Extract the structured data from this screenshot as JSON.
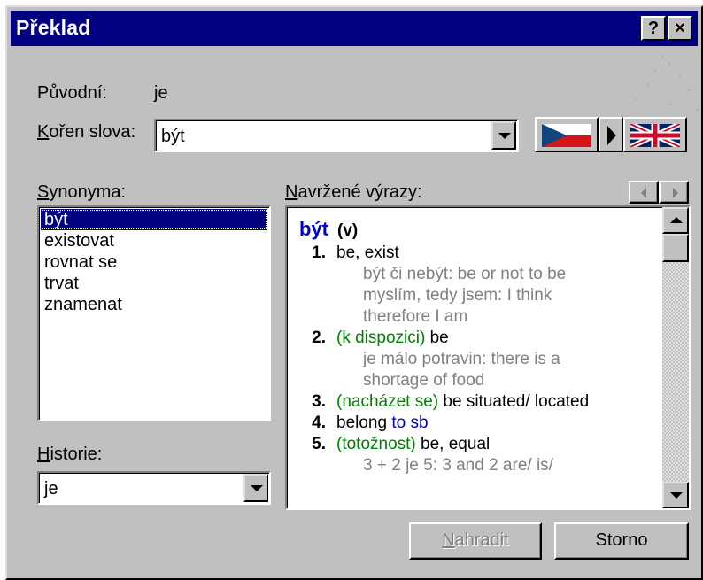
{
  "window": {
    "title": "Překlad",
    "help_label": "?",
    "close_label": "×"
  },
  "original": {
    "label": "Původní:",
    "value": "je"
  },
  "root": {
    "label_accel": "K",
    "label_rest": "ořen slova:",
    "value": "být"
  },
  "flags": {
    "source": "czech-flag-icon",
    "direction": "arrow-right-icon",
    "target": "uk-flag-icon"
  },
  "synonyms": {
    "label_accel": "S",
    "label_rest": "ynonyma:",
    "items": [
      {
        "text": "být",
        "selected": true
      },
      {
        "text": "existovat",
        "selected": false
      },
      {
        "text": "rovnat se",
        "selected": false
      },
      {
        "text": "trvat",
        "selected": false
      },
      {
        "text": "znamenat",
        "selected": false
      }
    ]
  },
  "suggestions": {
    "label_accel": "N",
    "label_rest": "avržené výrazy:",
    "headword": "být",
    "pos": "(v)",
    "entries": [
      {
        "kind": "sense",
        "num": "1.",
        "qualifier": "",
        "text": "be, exist",
        "extra": ""
      },
      {
        "kind": "example",
        "text": "být či nebýt: be or not to be"
      },
      {
        "kind": "example",
        "text": "myslím, tedy jsem: I think"
      },
      {
        "kind": "example",
        "text": "therefore  I am"
      },
      {
        "kind": "sense",
        "num": "2.",
        "qualifier": "(k dispozici)",
        "text": "be",
        "extra": ""
      },
      {
        "kind": "example",
        "text": "je málo potravin: there is a"
      },
      {
        "kind": "example",
        "text": "shortage  of food"
      },
      {
        "kind": "sense",
        "num": "3.",
        "qualifier": "(nacházet se)",
        "text": "be situated/ located",
        "extra": ""
      },
      {
        "kind": "sense",
        "num": "4.",
        "qualifier": "",
        "text": "belong",
        "extra": "to sb"
      },
      {
        "kind": "sense",
        "num": "5.",
        "qualifier": "(totožnost)",
        "text": "be, equal",
        "extra": ""
      },
      {
        "kind": "example",
        "text": "3 + 2 je 5: 3 and 2 are/ is/"
      }
    ]
  },
  "history": {
    "label_accel": "H",
    "label_rest": "istorie:",
    "value": "je"
  },
  "buttons": {
    "replace_accel": "N",
    "replace_rest": "ahradit",
    "cancel": "Storno"
  },
  "colors": {
    "title_bar": "#000080",
    "selection": "#000080",
    "headword": "#0000cc",
    "qualifier": "#008000",
    "example": "#808080"
  }
}
